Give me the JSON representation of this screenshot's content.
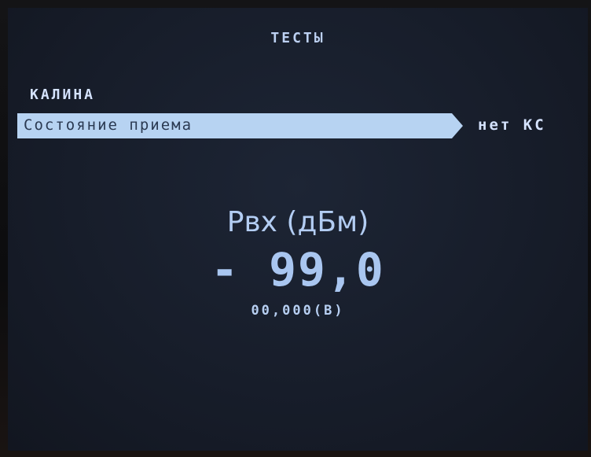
{
  "screen": {
    "title": "ТЕСТЫ",
    "section": "КАЛИНА",
    "selected_row": {
      "label": "Состояние приема",
      "value": "нет КС"
    },
    "measurement": {
      "label": "Pвх (дБм)",
      "value": "- 99,0",
      "voltage": "00,000(В)"
    }
  }
}
